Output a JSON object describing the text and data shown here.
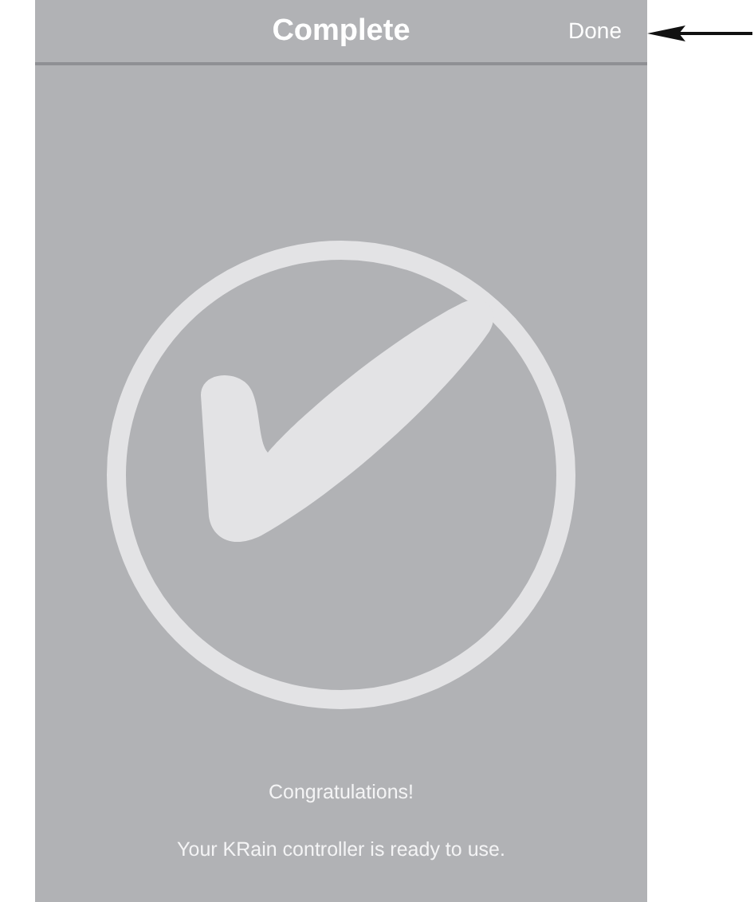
{
  "nav_bar": {
    "title": "Complete",
    "done_button": "Done"
  },
  "messages": [
    "Congratulations!",
    "Your KRain controller is ready to use."
  ]
}
